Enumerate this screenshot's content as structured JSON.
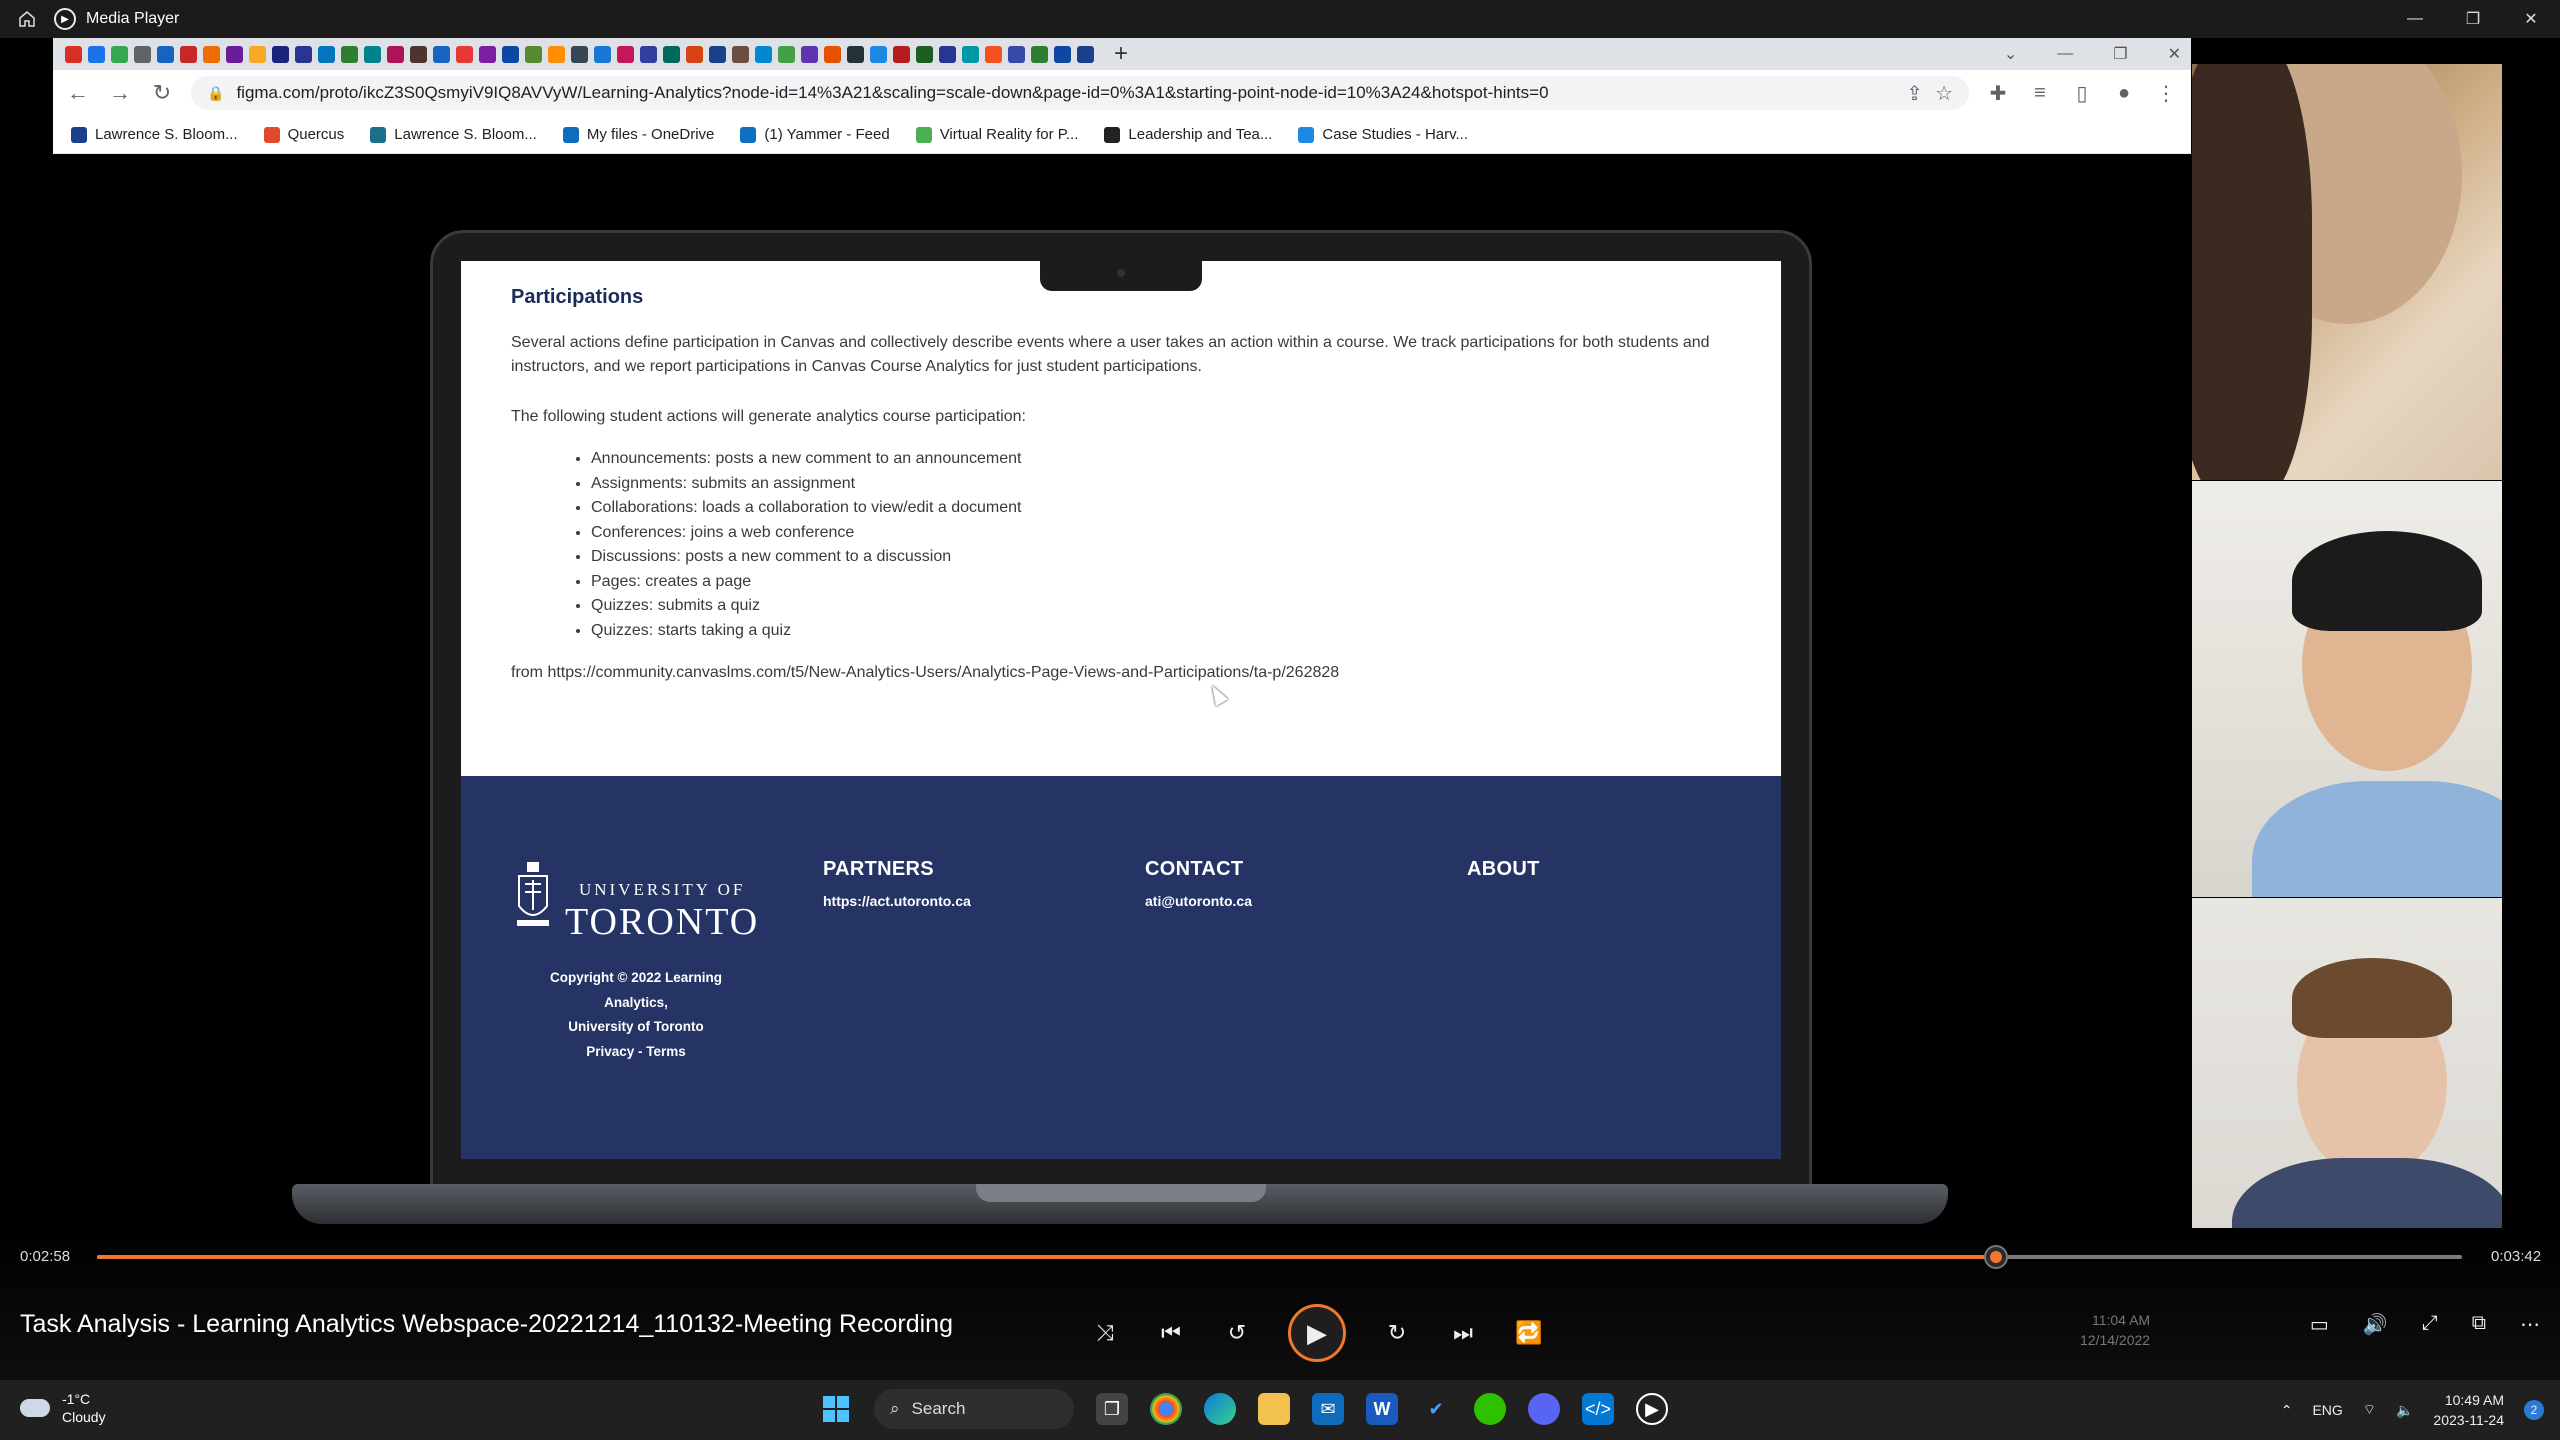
{
  "app": {
    "title": "Media Player"
  },
  "browser": {
    "url": "figma.com/proto/ikcZ3S0QsmyiV9IQ8AVVyW/Learning-Analytics?node-id=14%3A21&scaling=scale-down&page-id=0%3A1&starting-point-node-id=10%3A24&hotspot-hints=0",
    "bookmarks": [
      {
        "label": "Lawrence S. Bloom...",
        "color": "#1a3f8b"
      },
      {
        "label": "Quercus",
        "color": "#e2492b"
      },
      {
        "label": "Lawrence S. Bloom...",
        "color": "#1a6f8b"
      },
      {
        "label": "My files - OneDrive",
        "color": "#0f6cbd"
      },
      {
        "label": "(1) Yammer - Feed",
        "color": "#106ebe"
      },
      {
        "label": "Virtual Reality for P...",
        "color": "#4caf50"
      },
      {
        "label": "Leadership and Tea...",
        "color": "#222222"
      },
      {
        "label": "Case Studies - Harv...",
        "color": "#1e88e5"
      }
    ]
  },
  "page": {
    "heading": "Participations",
    "intro": "Several actions define participation in Canvas and collectively describe events where a user takes an action within a course. We track participations for both students and instructors, and we report participations in Canvas Course Analytics for just student participations.",
    "lead": "The following student actions will generate analytics course participation:",
    "actions": [
      "Announcements: posts a new comment to an announcement",
      "Assignments: submits an assignment",
      "Collaborations: loads a collaboration to view/edit a document",
      "Conferences: joins a web conference",
      "Discussions: posts a new comment to a discussion",
      "Pages: creates a page",
      "Quizzes: submits a quiz",
      "Quizzes: starts taking a quiz"
    ],
    "source": "from https://community.canvaslms.com/t5/New-Analytics-Users/Analytics-Page-Views-and-Participations/ta-p/262828"
  },
  "footer": {
    "uni_line1": "UNIVERSITY OF",
    "uni_line2": "TORONTO",
    "copyright_1": "Copyright © 2022 Learning Analytics,",
    "copyright_2": "University of Toronto",
    "copyright_3": "Privacy - Terms",
    "partners_title": "PARTNERS",
    "partners_link": "https://act.utoronto.ca",
    "contact_title": "CONTACT",
    "contact_link": "ati@utoronto.ca",
    "about_title": "ABOUT"
  },
  "player": {
    "elapsed": "0:02:58",
    "total": "0:03:42",
    "progress": 0.803,
    "media_title": "Task Analysis - Learning Analytics Webspace-20221214_110132-Meeting Recording",
    "rec_time": "11:04 AM",
    "rec_date": "12/14/2022"
  },
  "taskbar": {
    "temp": "-1°C",
    "condition": "Cloudy",
    "search_label": "Search",
    "lang": "ENG",
    "time": "10:49 AM",
    "date": "2023-11-24",
    "notif_count": "2"
  },
  "colors": {
    "accent": "#f2772e",
    "footer_bg": "#253464",
    "heading": "#1c2b5a"
  }
}
